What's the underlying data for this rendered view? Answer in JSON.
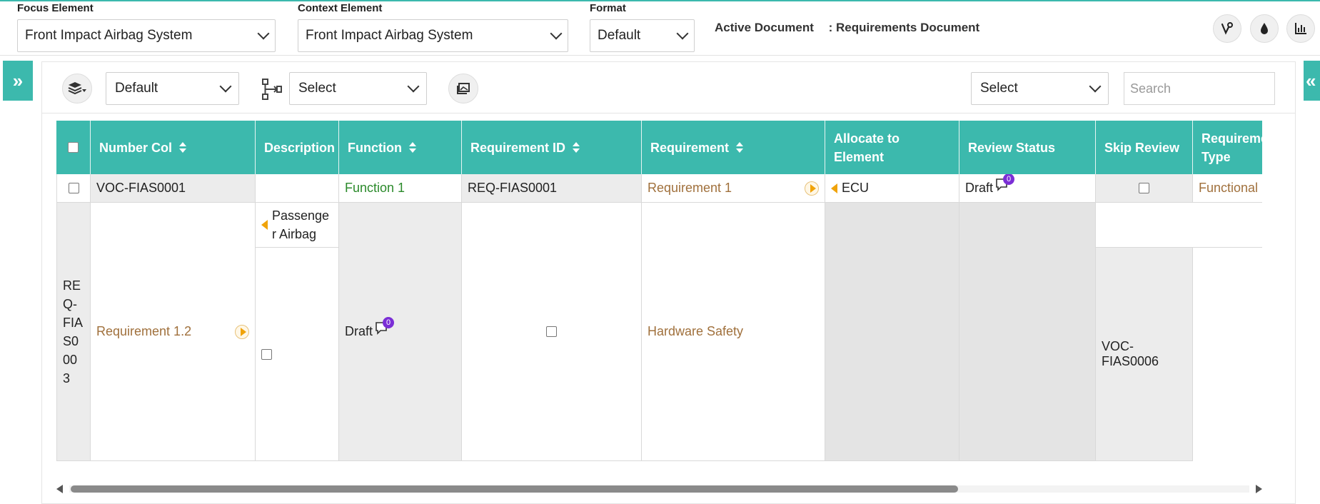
{
  "header": {
    "focus_label": "Focus Element",
    "focus_value": "Front Impact Airbag System",
    "context_label": "Context Element",
    "context_value": "Front Impact Airbag System",
    "format_label": "Format",
    "format_value": "Default",
    "active_doc_label": "Active Document",
    "active_doc_value": ": Requirements Document",
    "icons": [
      "vine-icon",
      "drop-icon",
      "bar-chart-icon"
    ]
  },
  "toolbar": {
    "view_value": "Default",
    "hierarchy_value": "Select",
    "filter_value": "Select",
    "search_placeholder": "Search"
  },
  "grid": {
    "columns": [
      "Number Col",
      "Description",
      "Function",
      "Requirement ID",
      "Requirement",
      "Allocate to Element",
      "Review Status",
      "Skip Review",
      "Requirement Type"
    ],
    "row1": {
      "number": "VOC-FIAS0001",
      "function": "Function 1",
      "req_id": "REQ-FIAS0001",
      "requirement": "Requirement 1",
      "allocate": "ECU",
      "review": "Draft",
      "review_comments": "0",
      "req_type": "Functional"
    },
    "row2": {
      "id": "REQ-FIAS0003",
      "number": "Requirement 1.2",
      "description": "Passenger Airbag",
      "function": "Draft",
      "function_comments": "0",
      "requirement": "Hardware Safety",
      "skip": "VOC-FIAS0006"
    }
  },
  "colors": {
    "accent": "#3cb9ad",
    "link_brown": "#a0703c",
    "link_green": "#2b8a2b",
    "badge": "#7b2ed6"
  }
}
